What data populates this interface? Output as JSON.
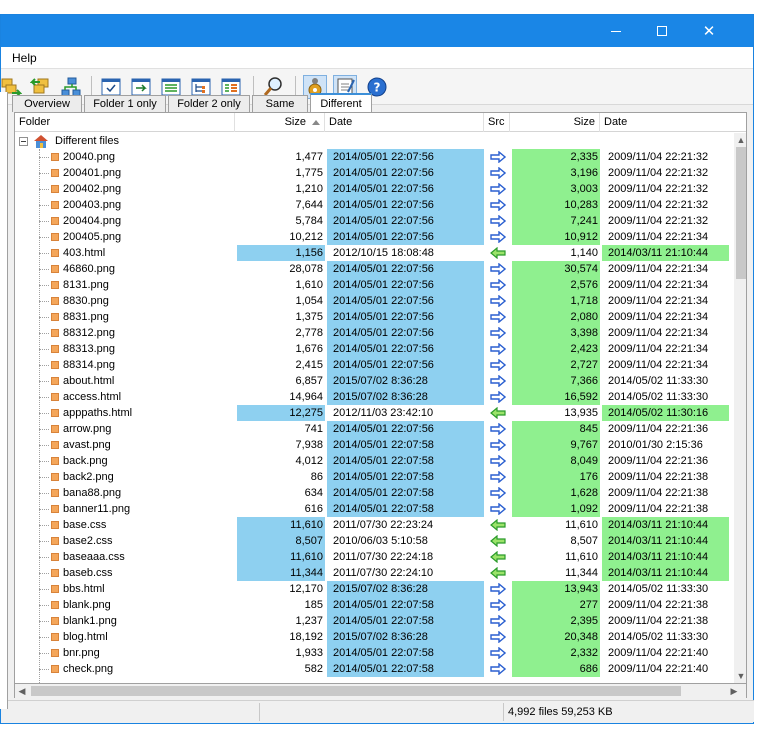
{
  "window": {
    "menu_help": "Help"
  },
  "colors": {
    "title_bar": "#1a86e6",
    "src_highlight": "#8ed0f0",
    "dst_highlight": "#8ff08f"
  },
  "tabs": [
    "Overview",
    "Folder 1 only",
    "Folder 2 only",
    "Same",
    "Different"
  ],
  "active_tab": "Different",
  "columns": {
    "folder": "Folder",
    "size1": "Size",
    "date1": "Date",
    "src": "Src",
    "size2": "Size",
    "date2": "Date"
  },
  "group_label": "Different files",
  "rows": [
    {
      "name": "20040.png",
      "size1": "1,477",
      "date1": "2014/05/01 22:07:56",
      "dir": "right",
      "size2": "2,335",
      "date2": "2009/11/04 22:21:32"
    },
    {
      "name": "200401.png",
      "size1": "1,775",
      "date1": "2014/05/01 22:07:56",
      "dir": "right",
      "size2": "3,196",
      "date2": "2009/11/04 22:21:32"
    },
    {
      "name": "200402.png",
      "size1": "1,210",
      "date1": "2014/05/01 22:07:56",
      "dir": "right",
      "size2": "3,003",
      "date2": "2009/11/04 22:21:32"
    },
    {
      "name": "200403.png",
      "size1": "7,644",
      "date1": "2014/05/01 22:07:56",
      "dir": "right",
      "size2": "10,283",
      "date2": "2009/11/04 22:21:32"
    },
    {
      "name": "200404.png",
      "size1": "5,784",
      "date1": "2014/05/01 22:07:56",
      "dir": "right",
      "size2": "7,241",
      "date2": "2009/11/04 22:21:32"
    },
    {
      "name": "200405.png",
      "size1": "10,212",
      "date1": "2014/05/01 22:07:56",
      "dir": "right",
      "size2": "10,912",
      "date2": "2009/11/04 22:21:34"
    },
    {
      "name": "403.html",
      "size1": "1,156",
      "date1": "2012/10/15 18:08:48",
      "dir": "left",
      "size2": "1,140",
      "date2": "2014/03/11 21:10:44"
    },
    {
      "name": "46860.png",
      "size1": "28,078",
      "date1": "2014/05/01 22:07:56",
      "dir": "right",
      "size2": "30,574",
      "date2": "2009/11/04 22:21:34"
    },
    {
      "name": "8131.png",
      "size1": "1,610",
      "date1": "2014/05/01 22:07:56",
      "dir": "right",
      "size2": "2,576",
      "date2": "2009/11/04 22:21:34"
    },
    {
      "name": "8830.png",
      "size1": "1,054",
      "date1": "2014/05/01 22:07:56",
      "dir": "right",
      "size2": "1,718",
      "date2": "2009/11/04 22:21:34"
    },
    {
      "name": "8831.png",
      "size1": "1,375",
      "date1": "2014/05/01 22:07:56",
      "dir": "right",
      "size2": "2,080",
      "date2": "2009/11/04 22:21:34"
    },
    {
      "name": "88312.png",
      "size1": "2,778",
      "date1": "2014/05/01 22:07:56",
      "dir": "right",
      "size2": "3,398",
      "date2": "2009/11/04 22:21:34"
    },
    {
      "name": "88313.png",
      "size1": "1,676",
      "date1": "2014/05/01 22:07:56",
      "dir": "right",
      "size2": "2,423",
      "date2": "2009/11/04 22:21:34"
    },
    {
      "name": "88314.png",
      "size1": "2,415",
      "date1": "2014/05/01 22:07:56",
      "dir": "right",
      "size2": "2,727",
      "date2": "2009/11/04 22:21:34"
    },
    {
      "name": "about.html",
      "size1": "6,857",
      "date1": "2015/07/02 8:36:28",
      "dir": "right",
      "size2": "7,366",
      "date2": "2014/05/02 11:33:30"
    },
    {
      "name": "access.html",
      "size1": "14,964",
      "date1": "2015/07/02 8:36:28",
      "dir": "right",
      "size2": "16,592",
      "date2": "2014/05/02 11:33:30"
    },
    {
      "name": "apppaths.html",
      "size1": "12,275",
      "date1": "2012/11/03 23:42:10",
      "dir": "left",
      "size2": "13,935",
      "date2": "2014/05/02 11:30:16"
    },
    {
      "name": "arrow.png",
      "size1": "741",
      "date1": "2014/05/01 22:07:56",
      "dir": "right",
      "size2": "845",
      "date2": "2009/11/04 22:21:36"
    },
    {
      "name": "avast.png",
      "size1": "7,938",
      "date1": "2014/05/01 22:07:58",
      "dir": "right",
      "size2": "9,767",
      "date2": "2010/01/30 2:15:36"
    },
    {
      "name": "back.png",
      "size1": "4,012",
      "date1": "2014/05/01 22:07:58",
      "dir": "right",
      "size2": "8,049",
      "date2": "2009/11/04 22:21:36"
    },
    {
      "name": "back2.png",
      "size1": "86",
      "date1": "2014/05/01 22:07:58",
      "dir": "right",
      "size2": "176",
      "date2": "2009/11/04 22:21:38"
    },
    {
      "name": "bana88.png",
      "size1": "634",
      "date1": "2014/05/01 22:07:58",
      "dir": "right",
      "size2": "1,628",
      "date2": "2009/11/04 22:21:38"
    },
    {
      "name": "banner11.png",
      "size1": "616",
      "date1": "2014/05/01 22:07:58",
      "dir": "right",
      "size2": "1,092",
      "date2": "2009/11/04 22:21:38"
    },
    {
      "name": "base.css",
      "size1": "11,610",
      "date1": "2011/07/30 22:23:24",
      "dir": "left",
      "size2": "11,610",
      "date2": "2014/03/11 21:10:44"
    },
    {
      "name": "base2.css",
      "size1": "8,507",
      "date1": "2010/06/03 5:10:58",
      "dir": "left",
      "size2": "8,507",
      "date2": "2014/03/11 21:10:44"
    },
    {
      "name": "baseaaa.css",
      "size1": "11,610",
      "date1": "2011/07/30 22:24:18",
      "dir": "left",
      "size2": "11,610",
      "date2": "2014/03/11 21:10:44"
    },
    {
      "name": "baseb.css",
      "size1": "11,344",
      "date1": "2011/07/30 22:24:10",
      "dir": "left",
      "size2": "11,344",
      "date2": "2014/03/11 21:10:44"
    },
    {
      "name": "bbs.html",
      "size1": "12,170",
      "date1": "2015/07/02 8:36:28",
      "dir": "right",
      "size2": "13,943",
      "date2": "2014/05/02 11:33:30"
    },
    {
      "name": "blank.png",
      "size1": "185",
      "date1": "2014/05/01 22:07:58",
      "dir": "right",
      "size2": "277",
      "date2": "2009/11/04 22:21:38"
    },
    {
      "name": "blank1.png",
      "size1": "1,237",
      "date1": "2014/05/01 22:07:58",
      "dir": "right",
      "size2": "2,395",
      "date2": "2009/11/04 22:21:38"
    },
    {
      "name": "blog.html",
      "size1": "18,192",
      "date1": "2015/07/02 8:36:28",
      "dir": "right",
      "size2": "20,348",
      "date2": "2014/05/02 11:33:30"
    },
    {
      "name": "bnr.png",
      "size1": "1,933",
      "date1": "2014/05/01 22:07:58",
      "dir": "right",
      "size2": "2,332",
      "date2": "2009/11/04 22:21:40"
    },
    {
      "name": "check.png",
      "size1": "582",
      "date1": "2014/05/01 22:07:58",
      "dir": "right",
      "size2": "686",
      "date2": "2009/11/04 22:21:40"
    }
  ],
  "status": {
    "summary": "4,992 files 59,253 KB"
  }
}
